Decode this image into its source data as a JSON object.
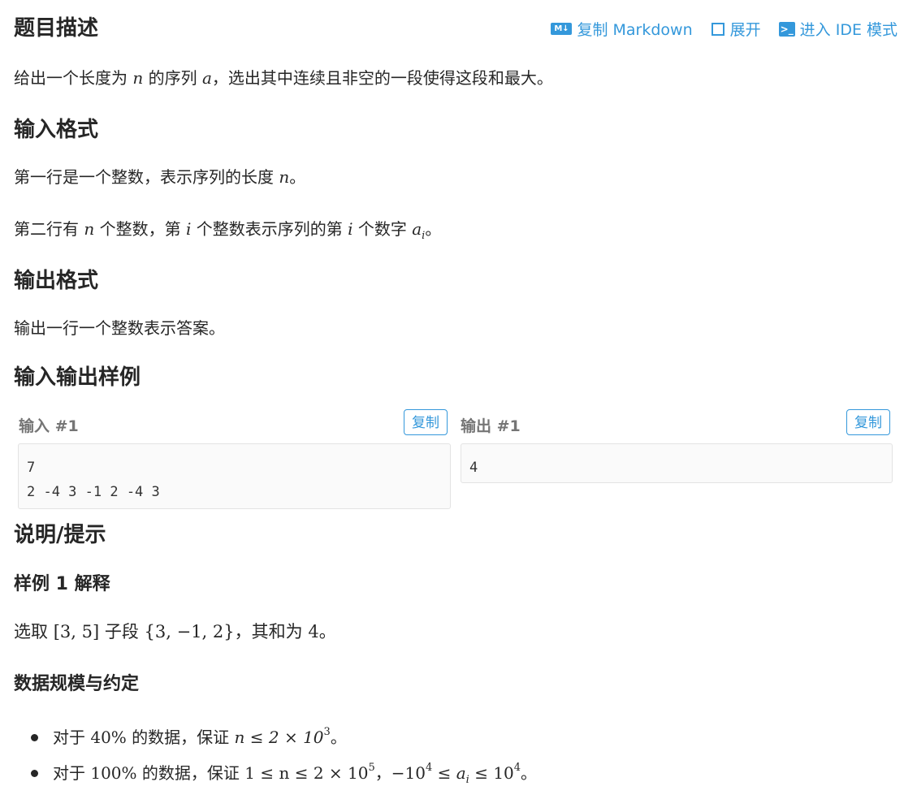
{
  "header": {
    "title": "题目描述",
    "actions": {
      "copy_markdown": "复制 Markdown",
      "expand": "展开",
      "ide_mode": "进入 IDE 模式",
      "md_icon_text": "M↓",
      "ide_icon_text": ">_"
    }
  },
  "description": {
    "text": {
      "p1": "给出一个长度为",
      "n": "n",
      "p2": "的序列",
      "a": "a",
      "p3": "，选出其中连续且非空的一段使得这段和最大。"
    }
  },
  "input_format": {
    "heading": "输入格式",
    "line1": {
      "pre": "第一行是一个整数，表示序列的长度",
      "n": "n",
      "post": "。"
    },
    "line2": {
      "pre": "第二行有",
      "n": "n",
      "mid1": "个整数，第",
      "i": "i",
      "mid2": "个整数表示序列的第",
      "i2": "i",
      "mid3": "个数字",
      "a": "a",
      "sub": "i",
      "post": "。"
    }
  },
  "output_format": {
    "heading": "输出格式",
    "line": "输出一行一个整数表示答案。"
  },
  "samples": {
    "heading": "输入输出样例",
    "input_label": "输入 #1",
    "output_label": "输出 #1",
    "copy_label": "复制",
    "input_code": "7\n2 -4 3 -1 2 -4 3",
    "output_code": "4"
  },
  "notes": {
    "heading": "说明/提示",
    "sample_explain_heading": "样例 1 解释",
    "explain": {
      "pre": "选取",
      "range": "[3, 5]",
      "mid": "子段",
      "set": "{3, −1, 2}",
      "mid2": "，其和为",
      "val": "4",
      "post": "。"
    },
    "limits_heading": "数据规模与约定",
    "limits": [
      {
        "pre": "对于",
        "pct": "40%",
        "mid": "的数据，保证",
        "expr": "n ≤ 2 × 10",
        "exp": "3",
        "post": "。"
      },
      {
        "pre": "对于",
        "pct": "100%",
        "mid": "的数据，保证",
        "expr": "1 ≤ n ≤ 2 × 10",
        "exp": "5",
        "mid2": "，",
        "expr2a": "−10",
        "exp2a": "4",
        "expr2b": " ≤ ",
        "a": "a",
        "sub": "i",
        "expr2c": " ≤ 10",
        "exp2c": "4",
        "post": "。"
      }
    ]
  },
  "colors": {
    "accent": "#3498db",
    "text": "#262626",
    "label_gray": "#757575"
  }
}
